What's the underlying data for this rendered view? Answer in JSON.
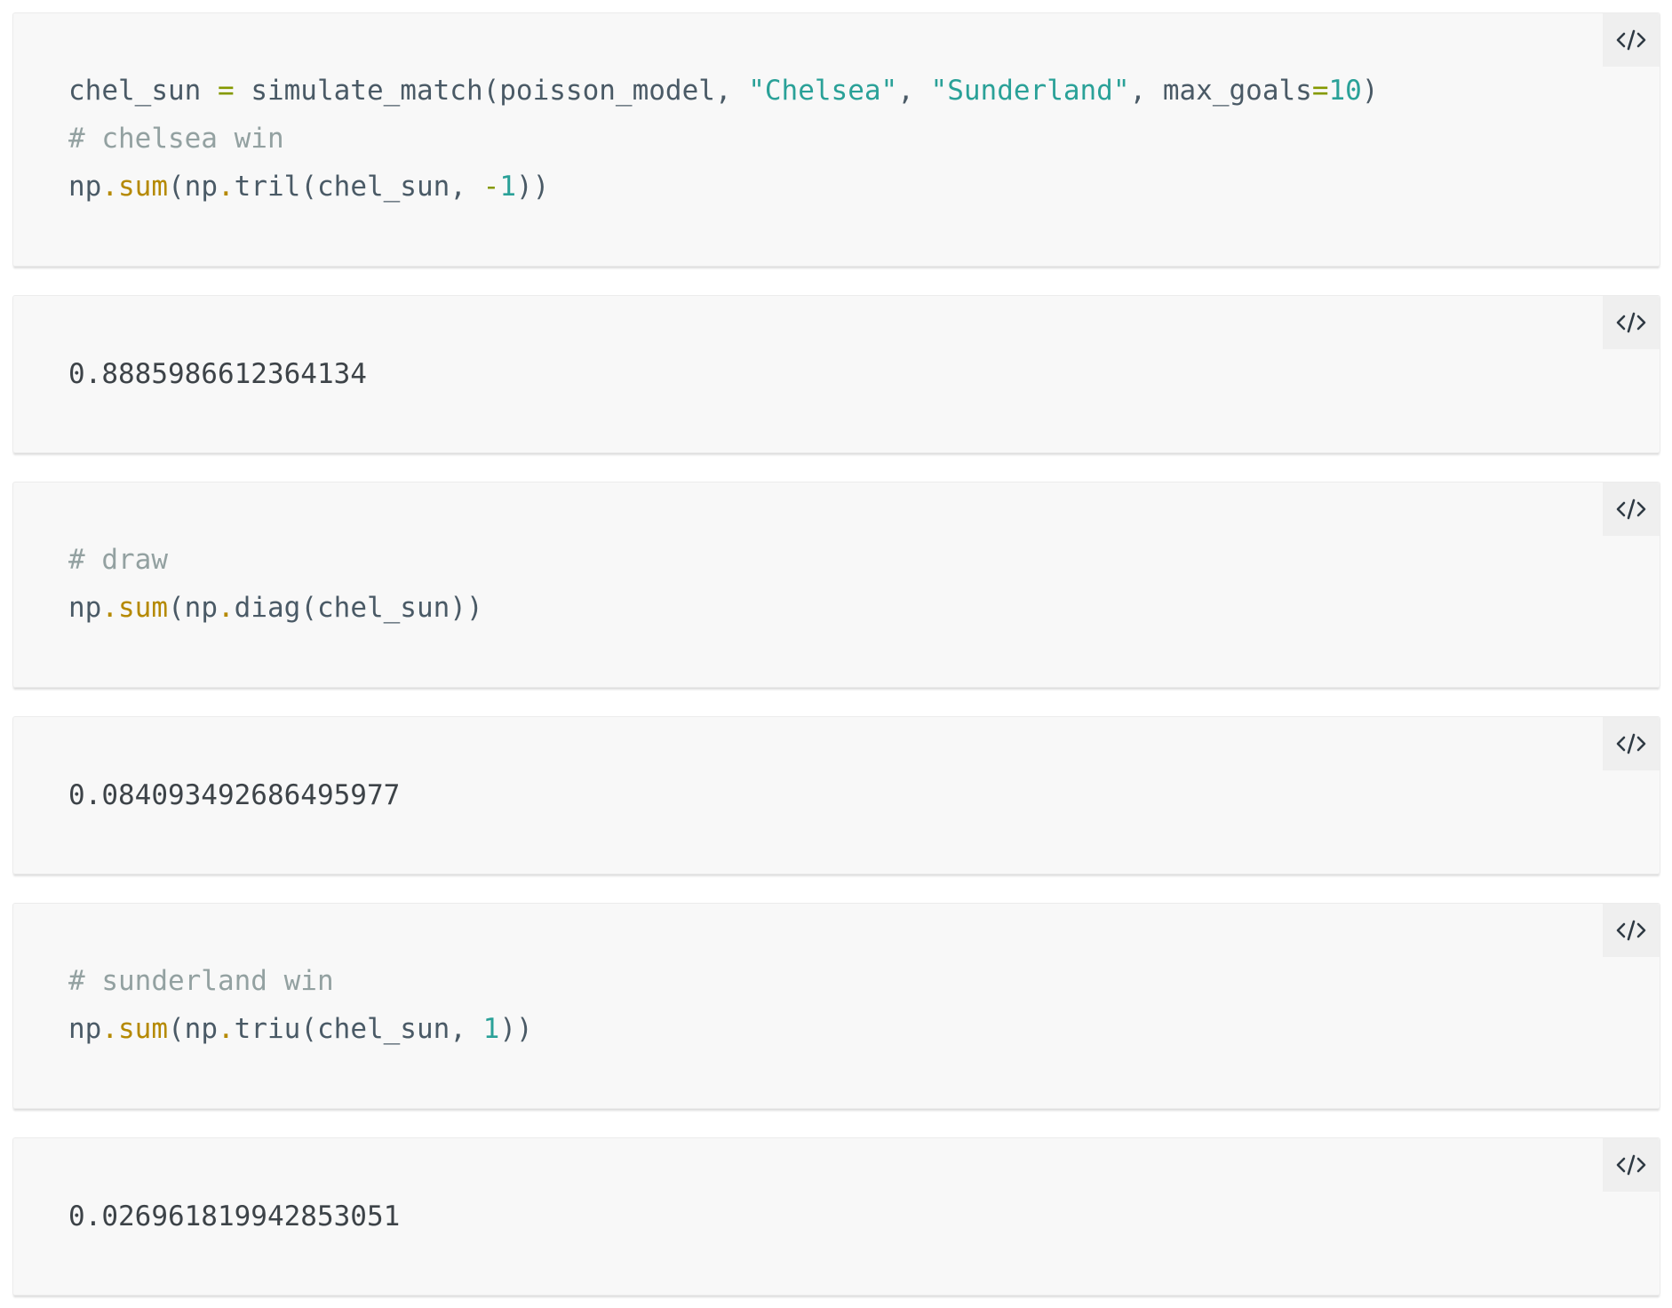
{
  "page": {
    "copy_icon_name": "code-icon",
    "colors": {
      "cell_bg": "#f8f8f8",
      "text": "#4a5a66",
      "comment": "#93a1a1",
      "string": "#2aa198",
      "number": "#2aa198",
      "operator": "#859900",
      "builtin": "#b58900"
    }
  },
  "cells": [
    {
      "kind": "input",
      "lines": [
        {
          "parts": [
            {
              "text": "chel_sun ",
              "type": "plain"
            },
            {
              "text": "=",
              "type": "operator"
            },
            {
              "text": " simulate_match(poisson_model, ",
              "type": "plain"
            },
            {
              "text": "\"Chelsea\"",
              "type": "string"
            },
            {
              "text": ", ",
              "type": "plain"
            },
            {
              "text": "\"Sunderland\"",
              "type": "string"
            },
            {
              "text": ", max_goals",
              "type": "plain"
            },
            {
              "text": "=",
              "type": "operator"
            },
            {
              "text": "10",
              "type": "number"
            },
            {
              "text": ")",
              "type": "plain"
            }
          ]
        },
        {
          "parts": [
            {
              "text": "# chelsea win",
              "type": "comment"
            }
          ]
        },
        {
          "parts": [
            {
              "text": "np",
              "type": "plain"
            },
            {
              "text": ".",
              "type": "dot"
            },
            {
              "text": "sum",
              "type": "builtin"
            },
            {
              "text": "(np",
              "type": "plain"
            },
            {
              "text": ".",
              "type": "dot"
            },
            {
              "text": "tril(chel_sun, ",
              "type": "plain"
            },
            {
              "text": "-",
              "type": "operator"
            },
            {
              "text": "1",
              "type": "number"
            },
            {
              "text": "))",
              "type": "plain"
            }
          ]
        }
      ]
    },
    {
      "kind": "output",
      "text": "0.8885986612364134"
    },
    {
      "kind": "input",
      "lines": [
        {
          "parts": [
            {
              "text": "# draw",
              "type": "comment"
            }
          ]
        },
        {
          "parts": [
            {
              "text": "np",
              "type": "plain"
            },
            {
              "text": ".",
              "type": "dot"
            },
            {
              "text": "sum",
              "type": "builtin"
            },
            {
              "text": "(np",
              "type": "plain"
            },
            {
              "text": ".",
              "type": "dot"
            },
            {
              "text": "diag(chel_sun))",
              "type": "plain"
            }
          ]
        }
      ]
    },
    {
      "kind": "output",
      "text": "0.084093492686495977"
    },
    {
      "kind": "input",
      "lines": [
        {
          "parts": [
            {
              "text": "# sunderland win",
              "type": "comment"
            }
          ]
        },
        {
          "parts": [
            {
              "text": "np",
              "type": "plain"
            },
            {
              "text": ".",
              "type": "dot"
            },
            {
              "text": "sum",
              "type": "builtin"
            },
            {
              "text": "(np",
              "type": "plain"
            },
            {
              "text": ".",
              "type": "dot"
            },
            {
              "text": "triu(chel_sun, ",
              "type": "plain"
            },
            {
              "text": "1",
              "type": "number"
            },
            {
              "text": "))",
              "type": "plain"
            }
          ]
        }
      ]
    },
    {
      "kind": "output",
      "text": "0.026961819942853051"
    }
  ]
}
